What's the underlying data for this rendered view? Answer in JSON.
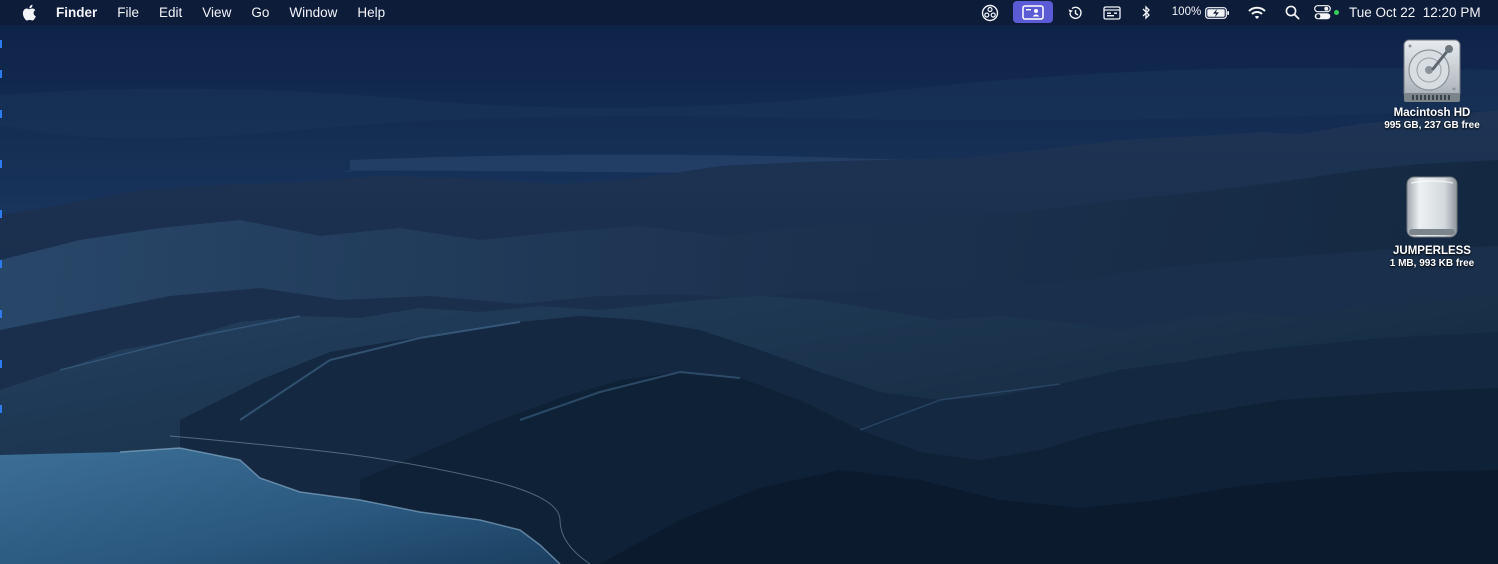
{
  "menubar": {
    "apple_icon": "apple-logo-icon",
    "app_name": "Finder",
    "menus": [
      "File",
      "Edit",
      "View",
      "Go",
      "Window",
      "Help"
    ],
    "status": {
      "icons": [
        "obs-icon",
        "screen-share-icon",
        "time-machine-icon",
        "display-icon",
        "bluetooth-icon",
        "battery-charging-icon",
        "wifi-icon",
        "search-icon",
        "control-center-icon"
      ],
      "battery_percent": "100%",
      "clock": "Tue Oct 22  12:20 PM",
      "screen_share_color": "#5b5bd6",
      "mic_indicator_color": "#35d05a"
    }
  },
  "desktop": {
    "icons": [
      {
        "name": "Macintosh HD",
        "info": "995 GB, 237 GB free",
        "icon": "internal-hard-drive-icon"
      },
      {
        "name": "JUMPERLESS",
        "info": "1 MB, 993 KB free",
        "icon": "external-drive-icon"
      }
    ]
  }
}
